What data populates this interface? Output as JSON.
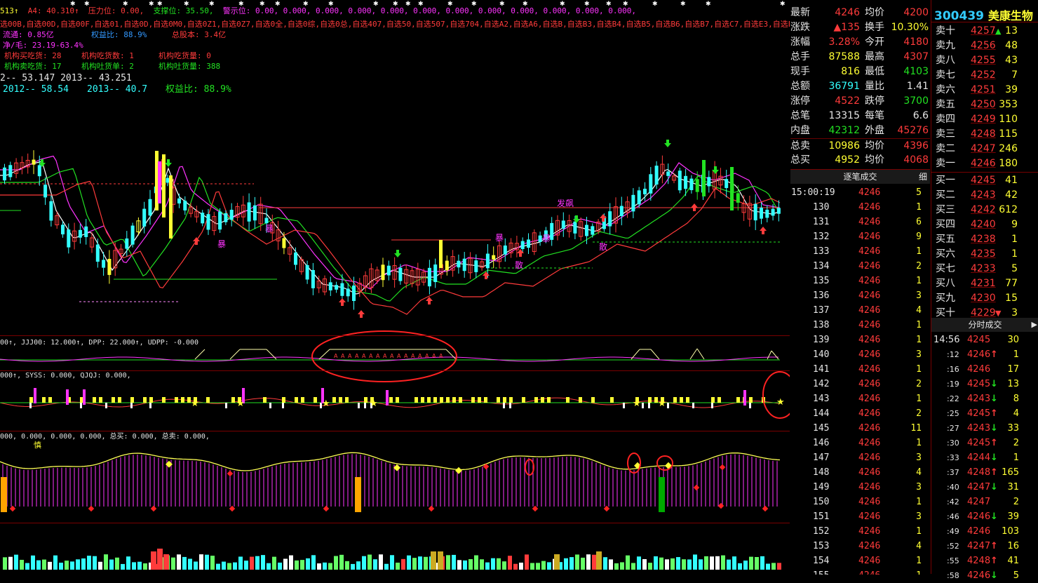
{
  "header": {
    "line1": [
      {
        "t": "513↑",
        "c": "#ffff33"
      },
      {
        "t": "A4: 40.310↑",
        "c": "#ff3b3b"
      },
      {
        "t": "压力位: 0.00,",
        "c": "#ff3b3b"
      },
      {
        "t": "支撑位: 35.50,",
        "c": "#22e222"
      },
      {
        "t": "警示位: 0.00, 0.000, 0.000, 0.000, 0.000, 0.000, 0.000, 0.000, 0.000, 0.000, 0.000, 0.000,",
        "c": "#ff33ff"
      }
    ],
    "line2": "选00B,自选00D,自选00F,自选01,自选0D,自选0M0,自选0Z1,自选0Z7,自选0全,自选0综,自选0总,自选407,自选50,自选507,自选704,自选A2,自选A6,自选B,自选B3,自选B4,自选B5,自选B6,自选B7,自选C7,自选E3,自选E",
    "line3": [
      {
        "t": "流通: 0.85亿",
        "c": "#ff33ff"
      },
      {
        "t": "权益比: 88.9%",
        "c": "#3399ff"
      },
      {
        "t": "总股本: 3.4亿",
        "c": "#ff3b3b"
      }
    ],
    "line4": "净/毛: 23.19-63.4%",
    "line5": [
      {
        "t": "机构买吃货: 28",
        "c": "#ff3b3b"
      },
      {
        "t": "机构吃货数: 1",
        "c": "#ff3b3b"
      },
      {
        "t": "机构吃货量: 0",
        "c": "#ff3b3b"
      }
    ],
    "line6": [
      {
        "t": "机构卖吃货: 17",
        "c": "#22e222"
      },
      {
        "t": "机构吐货单: 2",
        "c": "#22e222"
      },
      {
        "t": "机构吐货量: 388",
        "c": "#22e222"
      }
    ],
    "line7": "2-- 53.147   2013-- 43.251",
    "line8": [
      {
        "t": "2012-- 58.54",
        "c": "#33ffff"
      },
      {
        "t": "2013-- 40.7",
        "c": "#33ffff"
      },
      {
        "t": "权益比: 88.9%",
        "c": "#22e222"
      }
    ]
  },
  "chart_labels": {
    "fabao": "发飙",
    "bao1": "暴",
    "bao2": "暴",
    "bao3": "暴",
    "bao4": "暴",
    "san1": "散",
    "san2": "散"
  },
  "indicator1": {
    "text": "00↑, JJJ00: 12.000↑, DPP: 22.000↑, UDPP: -0.000"
  },
  "indicator2": {
    "text": "000↑, SYSS: 0.000, QJQJ: 0.000,"
  },
  "indicator3": {
    "text": "000, 0.000, 0.000, 0.000, 总买: 0.000, 总卖: 0.000,",
    "mark": "慎"
  },
  "quote": {
    "rows": [
      {
        "l1": "最新",
        "v1": "4246",
        "c1": "#ff3b3b",
        "l2": "均价",
        "v2": "4200",
        "c2": "#ff3b3b"
      },
      {
        "l1": "涨跌",
        "v1": "▲135",
        "c1": "#ff3b3b",
        "l2": "换手",
        "v2": "10.30%",
        "c2": "#ffff33"
      },
      {
        "l1": "涨幅",
        "v1": "3.28%",
        "c1": "#ff3b3b",
        "l2": "今开",
        "v2": "4180",
        "c2": "#ff3b3b"
      },
      {
        "l1": "总手",
        "v1": "87588",
        "c1": "#ffff33",
        "l2": "最高",
        "v2": "4307",
        "c2": "#ff3b3b"
      },
      {
        "l1": "现手",
        "v1": "816",
        "c1": "#ffff33",
        "l2": "最低",
        "v2": "4103",
        "c2": "#22e222"
      },
      {
        "l1": "总额",
        "v1": "36791",
        "c1": "#33ffff",
        "l2": "量比",
        "v2": "1.41",
        "c2": "#e6e6e6"
      },
      {
        "l1": "涨停",
        "v1": "4522",
        "c1": "#ff3b3b",
        "l2": "跌停",
        "v2": "3700",
        "c2": "#22e222"
      },
      {
        "l1": "总笔",
        "v1": "13315",
        "c1": "#e6e6e6",
        "l2": "每笔",
        "v2": "6.6",
        "c2": "#e6e6e6"
      },
      {
        "l1": "内盘",
        "v1": "42312",
        "c1": "#22e222",
        "l2": "外盘",
        "v2": "45276",
        "c2": "#ff3b3b"
      },
      {
        "l1": "总卖",
        "v1": "10986",
        "c1": "#ffff33",
        "l2": "均价",
        "v2": "4396",
        "c2": "#ff3b3b"
      },
      {
        "l1": "总买",
        "v1": "4952",
        "c1": "#ffff33",
        "l2": "均价",
        "v2": "4068",
        "c2": "#ff3b3b"
      }
    ]
  },
  "trades": {
    "tab_label": "逐笔成交",
    "tab_side": "细",
    "first_time": "15:00:19",
    "rows": [
      {
        "id": "",
        "p": "4246",
        "v": "5"
      },
      {
        "id": "130",
        "p": "4246",
        "v": "1"
      },
      {
        "id": "131",
        "p": "4246",
        "v": "6"
      },
      {
        "id": "132",
        "p": "4246",
        "v": "9"
      },
      {
        "id": "133",
        "p": "4246",
        "v": "1"
      },
      {
        "id": "134",
        "p": "4246",
        "v": "2"
      },
      {
        "id": "135",
        "p": "4246",
        "v": "1"
      },
      {
        "id": "136",
        "p": "4246",
        "v": "3"
      },
      {
        "id": "137",
        "p": "4246",
        "v": "4"
      },
      {
        "id": "138",
        "p": "4246",
        "v": "1"
      },
      {
        "id": "139",
        "p": "4246",
        "v": "1"
      },
      {
        "id": "140",
        "p": "4246",
        "v": "3"
      },
      {
        "id": "141",
        "p": "4246",
        "v": "1"
      },
      {
        "id": "142",
        "p": "4246",
        "v": "2"
      },
      {
        "id": "143",
        "p": "4246",
        "v": "1"
      },
      {
        "id": "144",
        "p": "4246",
        "v": "2"
      },
      {
        "id": "145",
        "p": "4246",
        "v": "11"
      },
      {
        "id": "146",
        "p": "4246",
        "v": "1"
      },
      {
        "id": "147",
        "p": "4246",
        "v": "3"
      },
      {
        "id": "148",
        "p": "4246",
        "v": "4"
      },
      {
        "id": "149",
        "p": "4246",
        "v": "3"
      },
      {
        "id": "150",
        "p": "4246",
        "v": "1"
      },
      {
        "id": "151",
        "p": "4246",
        "v": "3"
      },
      {
        "id": "152",
        "p": "4246",
        "v": "1"
      },
      {
        "id": "153",
        "p": "4246",
        "v": "4"
      },
      {
        "id": "154",
        "p": "4246",
        "v": "1"
      },
      {
        "id": "155",
        "p": "4246",
        "v": "1"
      }
    ]
  },
  "book": {
    "code": "300439",
    "name": "美康生物",
    "asks": [
      {
        "l": "卖十",
        "p": "4257",
        "a": "▲",
        "v": "13"
      },
      {
        "l": "卖九",
        "p": "4256",
        "a": "",
        "v": "48"
      },
      {
        "l": "卖八",
        "p": "4255",
        "a": "",
        "v": "43"
      },
      {
        "l": "卖七",
        "p": "4252",
        "a": "",
        "v": "7"
      },
      {
        "l": "卖六",
        "p": "4251",
        "a": "",
        "v": "39"
      },
      {
        "l": "卖五",
        "p": "4250",
        "a": "",
        "v": "353"
      },
      {
        "l": "卖四",
        "p": "4249",
        "a": "",
        "v": "110"
      },
      {
        "l": "卖三",
        "p": "4248",
        "a": "",
        "v": "115"
      },
      {
        "l": "卖二",
        "p": "4247",
        "a": "",
        "v": "246"
      },
      {
        "l": "卖一",
        "p": "4246",
        "a": "",
        "v": "180"
      }
    ],
    "bids": [
      {
        "l": "买一",
        "p": "4245",
        "a": "",
        "v": "41"
      },
      {
        "l": "买二",
        "p": "4243",
        "a": "",
        "v": "42"
      },
      {
        "l": "买三",
        "p": "4242",
        "a": "",
        "v": "612"
      },
      {
        "l": "买四",
        "p": "4240",
        "a": "",
        "v": "9"
      },
      {
        "l": "买五",
        "p": "4238",
        "a": "",
        "v": "1"
      },
      {
        "l": "买六",
        "p": "4235",
        "a": "",
        "v": "1"
      },
      {
        "l": "买七",
        "p": "4233",
        "a": "",
        "v": "5"
      },
      {
        "l": "买八",
        "p": "4231",
        "a": "",
        "v": "77"
      },
      {
        "l": "买九",
        "p": "4230",
        "a": "",
        "v": "15"
      },
      {
        "l": "买十",
        "p": "4229",
        "a": "▼",
        "v": "3"
      }
    ],
    "tab_label": "分时成交",
    "tab_arrow": "▶",
    "first_time": "14:56",
    "fills": [
      {
        "t": "",
        "p": "4245",
        "a": "",
        "ac": "#ff3b3b",
        "v": "30",
        "vc": "#ffff33"
      },
      {
        "t": ":12",
        "p": "4246",
        "a": "↑",
        "ac": "#ff3b3b",
        "v": "1",
        "vc": "#ffff33"
      },
      {
        "t": ":16",
        "p": "4246",
        "a": "",
        "ac": "#ff3b3b",
        "v": "17",
        "vc": "#ffff33"
      },
      {
        "t": ":19",
        "p": "4245",
        "a": "↓",
        "ac": "#22e222",
        "v": "13",
        "vc": "#ffff33"
      },
      {
        "t": ":22",
        "p": "4243",
        "a": "↓",
        "ac": "#22e222",
        "v": "8",
        "vc": "#ffff33"
      },
      {
        "t": ":25",
        "p": "4245",
        "a": "↑",
        "ac": "#ff3b3b",
        "v": "4",
        "vc": "#ffff33"
      },
      {
        "t": ":27",
        "p": "4243",
        "a": "↓",
        "ac": "#22e222",
        "v": "33",
        "vc": "#ffff33"
      },
      {
        "t": ":30",
        "p": "4245",
        "a": "↑",
        "ac": "#ff3b3b",
        "v": "2",
        "vc": "#ffff33"
      },
      {
        "t": ":33",
        "p": "4244",
        "a": "↓",
        "ac": "#22e222",
        "v": "1",
        "vc": "#ffff33"
      },
      {
        "t": ":37",
        "p": "4248",
        "a": "↑",
        "ac": "#ff3b3b",
        "v": "165",
        "vc": "#ffff33"
      },
      {
        "t": ":40",
        "p": "4247",
        "a": "↓",
        "ac": "#22e222",
        "v": "31",
        "vc": "#ffff33"
      },
      {
        "t": ":42",
        "p": "4247",
        "a": "",
        "ac": "#ff3b3b",
        "v": "2",
        "vc": "#ffff33"
      },
      {
        "t": ":46",
        "p": "4246",
        "a": "↓",
        "ac": "#22e222",
        "v": "39",
        "vc": "#ffff33"
      },
      {
        "t": ":49",
        "p": "4246",
        "a": "",
        "ac": "#ff3b3b",
        "v": "103",
        "vc": "#ffff33"
      },
      {
        "t": ":52",
        "p": "4247",
        "a": "↑",
        "ac": "#ff3b3b",
        "v": "16",
        "vc": "#ffff33"
      },
      {
        "t": ":55",
        "p": "4248",
        "a": "↑",
        "ac": "#ff3b3b",
        "v": "41",
        "vc": "#ffff33"
      },
      {
        "t": ":58",
        "p": "4246",
        "a": "↓",
        "ac": "#22e222",
        "v": "5",
        "vc": "#ffff33"
      }
    ]
  }
}
